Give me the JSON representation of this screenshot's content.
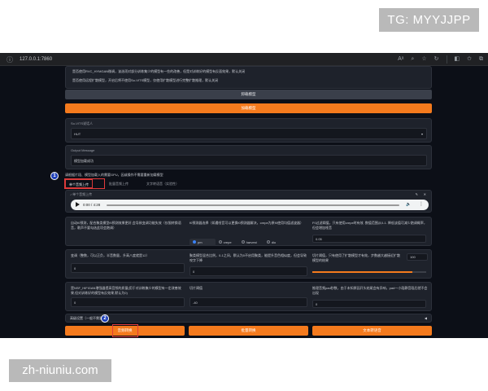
{
  "watermarks": {
    "top": "TG: MYYJJPP",
    "bottom": "zh-niuniu.com"
  },
  "browser": {
    "url": "127.0.0.1:7860",
    "icons": [
      "read-aloud-icon",
      "zoom-icon",
      "favorite-icon",
      "refresh-icon",
      "split-screen-icon",
      "favorites-icon",
      "collections-icon"
    ]
  },
  "top_panel": {
    "line1": "是否使用RVC_HYMGAN微调，该选项对部分训练集少的模型有一些的改善，但是对训练好的模型有反面效果，默认关闭",
    "line2": "是否使用远程扩散模型，开启后将不使用So-VITS模型，仅使用扩散模型进行完整扩散推理，默认关闭"
  },
  "buttons": {
    "unload_model": "卸载模型",
    "load_model": "加载模型",
    "convert_audio": "音频转换",
    "batch_convert": "批量转换",
    "text_convert": "文本转语音"
  },
  "speaker": {
    "label": "So-VITS说话人",
    "value": "HUT"
  },
  "output": {
    "label": "Output Message",
    "value": "模型加载成功"
  },
  "tip": "请根据片段、模型加载入的需要GPU，因或操作不需要重新加载模型",
  "tabs": [
    "单个音频上传",
    "批量音频上传",
    "文字转语音（实验性）"
  ],
  "audio": {
    "file_label": "单个音频上传",
    "time": "0:00 / 4:28"
  },
  "row1": {
    "f0_desc": "自动f0预测，配合聚类模型f0预测效果更好,会导致变调功能失效（仅限转换语音，歌声不要勾选此项会跑调）",
    "f0_method_label": "f0预测器选择（如遇哑音可以更换f0预测器解决，crepe为原f0使用均值滤波器）",
    "f0_options": [
      "pm",
      "crepe",
      "harvest",
      "dio"
    ],
    "f0_selected": 0,
    "threshold_label": "F0过滤阈值，只有使用crepe时有效. 数值范围从0-1. 降低该值可减少跑调概率，但会增加哑音",
    "threshold_value": "0.05"
  },
  "row2": {
    "pitch_label": "变调（整数，可以正负，半音数量，升高八度就是12）",
    "pitch_value": "0",
    "cluster_label": "聚类模型混合比例，0-1之间，默认为0不启用聚类，能提升音色相似度，但会导致咬字下降",
    "cluster_value": "0",
    "slice_label": "切片阈值，只有使用了扩散模型才有效，步数越大越接近扩散模型的结果",
    "slice_value": "100",
    "slice_fill": 0.88
  },
  "row3": {
    "nsf_label": "是NSF_HIFIGAN增强器提高音频的质量(用于对训练集少的模型有一定改善效果,但对训练好的模型有反效果,默认为0)",
    "nsf_value": "0",
    "db_label": "切片阈值",
    "db_value": "-40",
    "pad_label": "推理音频pad秒数，由于未知原因开头结尾会有异响，pad一小段静音段后就不会出现",
    "pad_value": "0"
  },
  "advanced": {
    "label": "高级设置（一般不需要动）",
    "arrow": "◀"
  },
  "markers": [
    "1",
    "2"
  ]
}
